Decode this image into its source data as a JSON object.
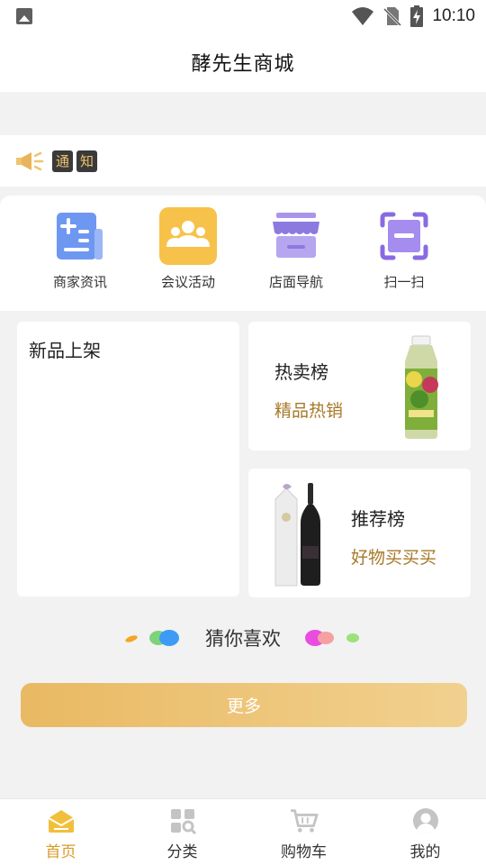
{
  "status_bar": {
    "time": "10:10"
  },
  "header": {
    "title": "酵先生商城"
  },
  "notice": {
    "tags": [
      "通",
      "知"
    ]
  },
  "quick_nav": [
    {
      "label": "商家资讯",
      "icon": "news-icon"
    },
    {
      "label": "会议活动",
      "icon": "people-icon"
    },
    {
      "label": "店面导航",
      "icon": "store-icon"
    },
    {
      "label": "扫一扫",
      "icon": "scan-icon"
    }
  ],
  "cards": {
    "new": {
      "title": "新品上架"
    },
    "hot": {
      "title": "热卖榜",
      "subtitle": "精品热销"
    },
    "recommend": {
      "title": "推荐榜",
      "subtitle": "好物买买买"
    }
  },
  "guess": {
    "title": "猜你喜欢"
  },
  "more_button": {
    "label": "更多"
  },
  "tabbar": [
    {
      "label": "首页",
      "icon": "home-icon",
      "active": true
    },
    {
      "label": "分类",
      "icon": "category-icon",
      "active": false
    },
    {
      "label": "购物车",
      "icon": "cart-icon",
      "active": false
    },
    {
      "label": "我的",
      "icon": "user-icon",
      "active": false
    }
  ],
  "colors": {
    "accent": "#d79b27",
    "subtitle": "#a8792a",
    "button_start": "#e9b963",
    "button_end": "#f1d18f"
  }
}
